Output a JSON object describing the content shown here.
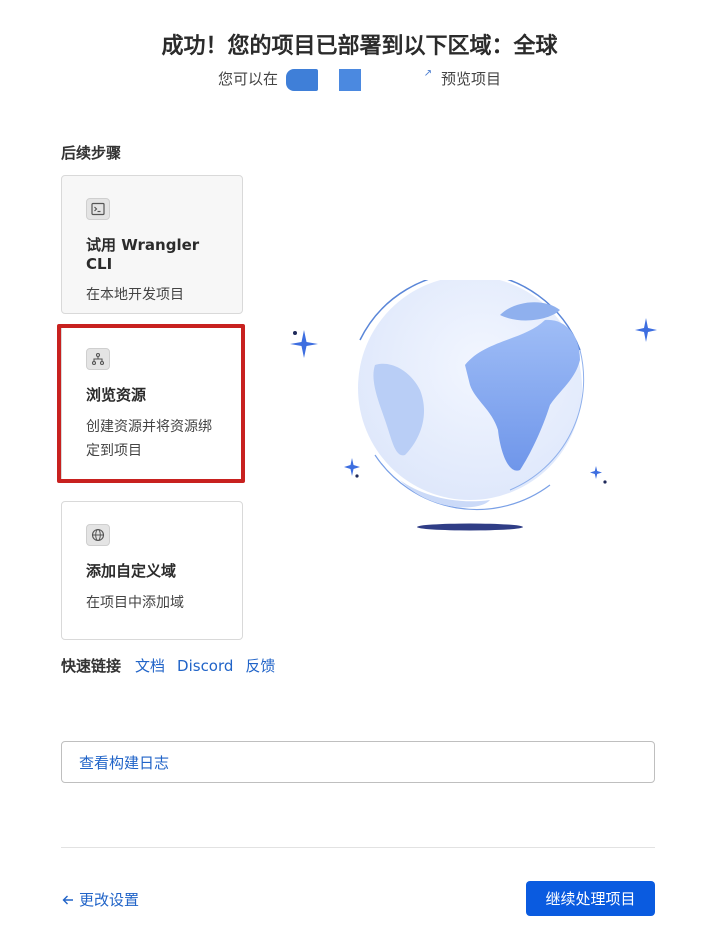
{
  "header": {
    "title": "成功！您的项目已部署到以下区域：全球",
    "subtitle_prefix": "您可以在",
    "subtitle_suffix": "预览项目"
  },
  "next_steps": {
    "label": "后续步骤",
    "cards": [
      {
        "icon": "terminal-icon",
        "title": "试用 Wrangler CLI",
        "desc": "在本地开发项目"
      },
      {
        "icon": "resources-icon",
        "title": "浏览资源",
        "desc": "创建资源并将资源绑定到项目"
      },
      {
        "icon": "globe-icon",
        "title": "添加自定义域",
        "desc": "在项目中添加域"
      }
    ]
  },
  "quick_links": {
    "label": "快速链接",
    "links": [
      "文档",
      "Discord",
      "反馈"
    ]
  },
  "build_log_button": "查看构建日志",
  "footer": {
    "back_label": "更改设置",
    "continue_label": "继续处理项目"
  },
  "colors": {
    "primary": "#0a5be0",
    "link": "#2164c8",
    "highlight": "#c8211f",
    "globe": "#7ea6f0"
  }
}
